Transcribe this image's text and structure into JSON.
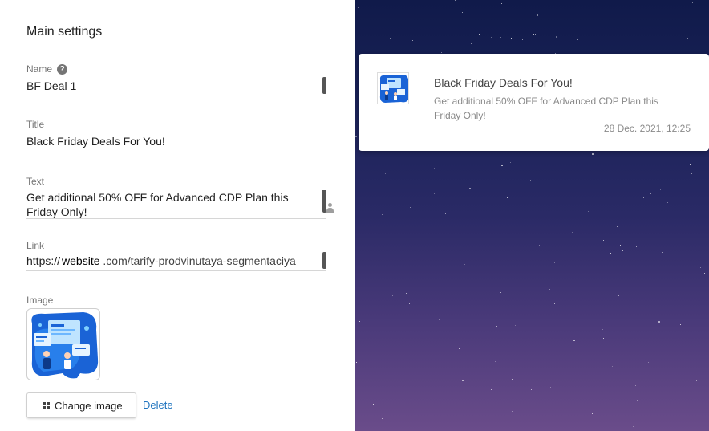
{
  "settings": {
    "title": "Main settings",
    "name_label": "Name",
    "name_value": "BF Deal 1",
    "title_label": "Title",
    "title_value": "Black Friday Deals For You!",
    "text_label": "Text",
    "text_value": "Get additional 50% OFF for Advanced CDP Plan this Friday Only!",
    "link_label": "Link",
    "link_prefix": "https://",
    "link_host": "website",
    "link_path": ".com/tarify-prodvinutaya-segmentaciya",
    "image_label": "Image",
    "change_image_label": "Change image",
    "delete_label": "Delete"
  },
  "preview": {
    "title": "Black Friday Deals For You!",
    "text": "Get additional 50% OFF for Advanced CDP Plan this Friday Only!",
    "time": "28 Dec. 2021, 12:25"
  },
  "icons": {
    "help": "help-circle-icon",
    "person": "person-icon",
    "change_image": "grid-icon"
  },
  "colors": {
    "link_accent": "#1e73be",
    "label": "#757575",
    "preview_bg_top": "#101a4a",
    "preview_bg_bottom": "#6a4c8a"
  }
}
